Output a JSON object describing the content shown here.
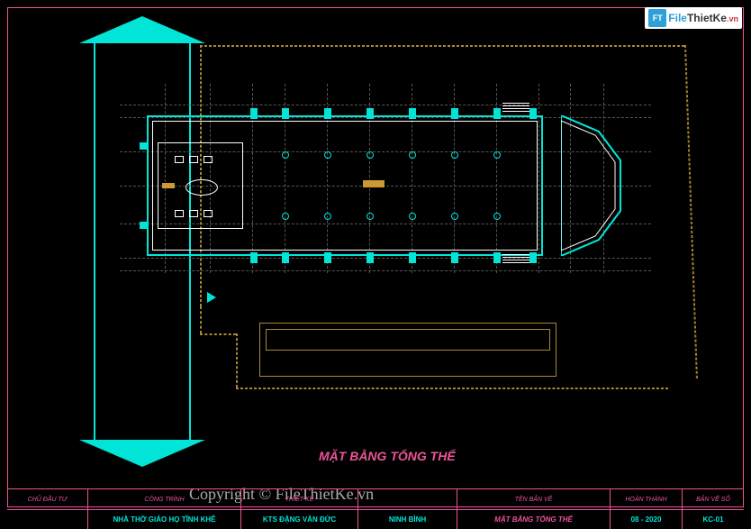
{
  "logo": {
    "brand1": "File",
    "brand2": "ThietKe",
    "tld": ".vn",
    "icon": "FT"
  },
  "plan_title": "MẶT BẰNG TỔNG THỂ",
  "watermark": "Copyright © FileThietKe.vn",
  "titleblock": {
    "headers": {
      "c1": "CHỦ ĐẦU TƯ",
      "c2": "CÔNG TRÌNH",
      "c3": "THIẾT KẾ",
      "c4": "",
      "c5": "TÊN BẢN VẼ",
      "c6": "HOÀN THÀNH",
      "c7": "BẢN VẼ SỐ"
    },
    "values": {
      "c1": "",
      "c2": "NHÀ THỜ GIÁO HỌ TĨNH KHÊ",
      "c3": "KTS ĐẶNG VĂN ĐỨC",
      "c4": "NINH BÌNH",
      "c5": "MẶT BẰNG TỔNG THỂ",
      "c6": "08 - 2020",
      "c7": "KC-01"
    }
  },
  "elements": {
    "arrow": "direction-arrow",
    "altar": "altar",
    "building": "church-outline",
    "aux_building": "auxiliary-building"
  }
}
